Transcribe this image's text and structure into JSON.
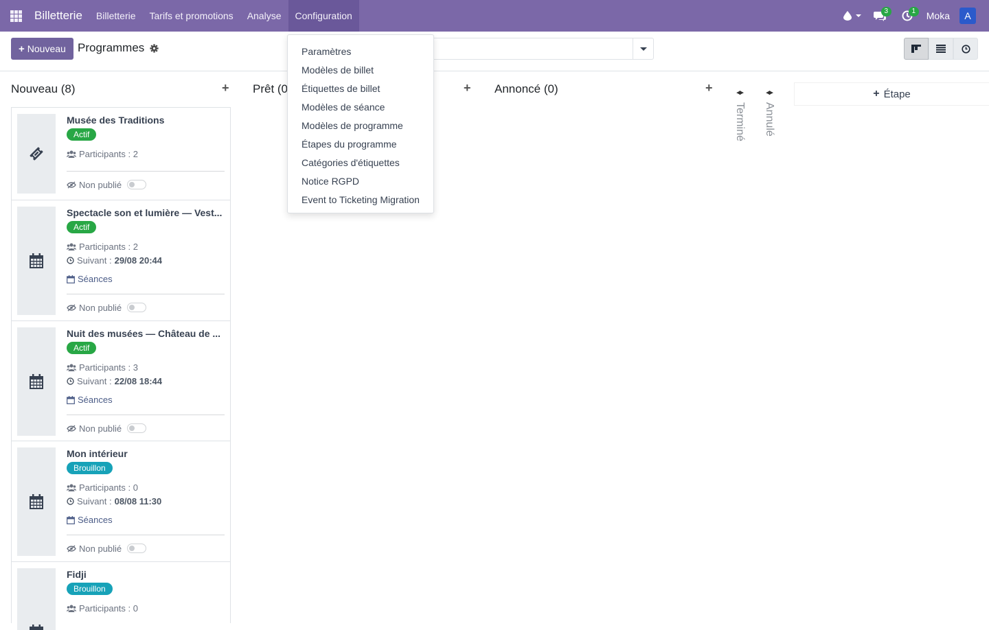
{
  "navbar": {
    "brand": "Billetterie",
    "menus": [
      "Billetterie",
      "Tarifs et promotions",
      "Analyse",
      "Configuration"
    ],
    "messages_count": "3",
    "activities_count": "1",
    "user_name": "Moka",
    "avatar_letter": "A"
  },
  "control": {
    "new_label": "Nouveau",
    "page_title": "Programmes"
  },
  "config_menu": {
    "items": [
      "Paramètres",
      "Modèles de billet",
      "Étiquettes de billet",
      "Modèles de séance",
      "Modèles de programme",
      "Étapes du programme",
      "Catégories d'étiquettes",
      "Notice RGPD",
      "Event to Ticketing Migration"
    ]
  },
  "columns": {
    "nouveau": "Nouveau (8)",
    "pret": "Prêt (0",
    "annonce": "Annoncé (0)",
    "termine": "Terminé",
    "annule": "Annulé",
    "add_stage": "Étape"
  },
  "cards": [
    {
      "title": "Musée des Traditions",
      "status": "Actif",
      "participants": "Participants : 2",
      "publish": "Non publié"
    },
    {
      "title": "Spectacle son et lumière — Vest...",
      "status": "Actif",
      "participants": "Participants : 2",
      "next_label": "Suivant :",
      "next_value": "29/08 20:44",
      "sessions": "Séances",
      "publish": "Non publié"
    },
    {
      "title": "Nuit des musées — Château de ...",
      "status": "Actif",
      "participants": "Participants : 3",
      "next_label": "Suivant :",
      "next_value": "22/08 18:44",
      "sessions": "Séances",
      "publish": "Non publié"
    },
    {
      "title": "Mon intérieur",
      "status": "Brouillon",
      "participants": "Participants : 0",
      "next_label": "Suivant :",
      "next_value": "08/08 11:30",
      "sessions": "Séances",
      "publish": "Non publié"
    },
    {
      "title": "Fidji",
      "status": "Brouillon",
      "participants": "Participants : 0"
    }
  ],
  "colors": {
    "navbar": "#7b68a8",
    "primary_button": "#71639e",
    "badge_active": "#28a745",
    "badge_draft": "#17a2b8"
  }
}
